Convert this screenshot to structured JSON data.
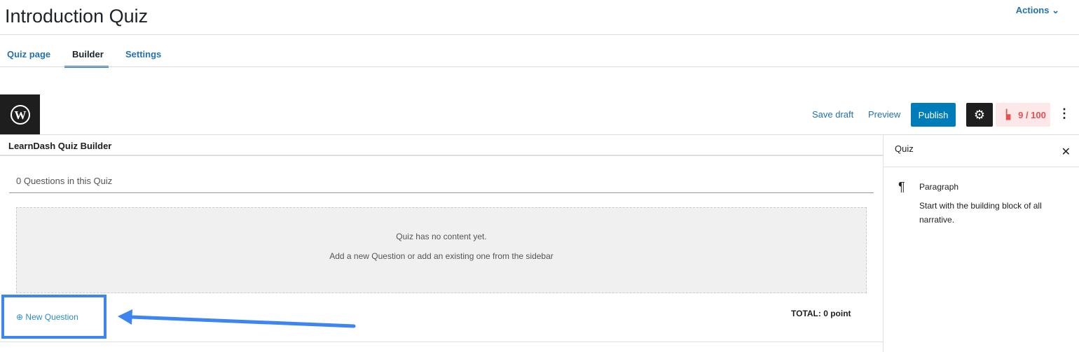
{
  "header": {
    "title": "Introduction Quiz",
    "actions_label": "Actions"
  },
  "tabs": [
    {
      "label": "Quiz page"
    },
    {
      "label": "Builder",
      "active": true
    },
    {
      "label": "Settings"
    }
  ],
  "toolbar": {
    "save_draft": "Save draft",
    "preview": "Preview",
    "publish": "Publish",
    "score": "9 / 100"
  },
  "builder": {
    "title": "LearnDash Quiz Builder",
    "count": "0 Questions in this Quiz",
    "empty_line1": "Quiz has no content yet.",
    "empty_line2": "Add a new Question or add an existing one from the sidebar",
    "new_question": "New Question",
    "total": "TOTAL: 0 point"
  },
  "sidebar": {
    "title": "Quiz",
    "block_name": "Paragraph",
    "block_desc": "Start with the building block of all narrative."
  },
  "colors": {
    "accent": "#007cba",
    "annotation": "#3d85f0",
    "score": "#e65054"
  }
}
